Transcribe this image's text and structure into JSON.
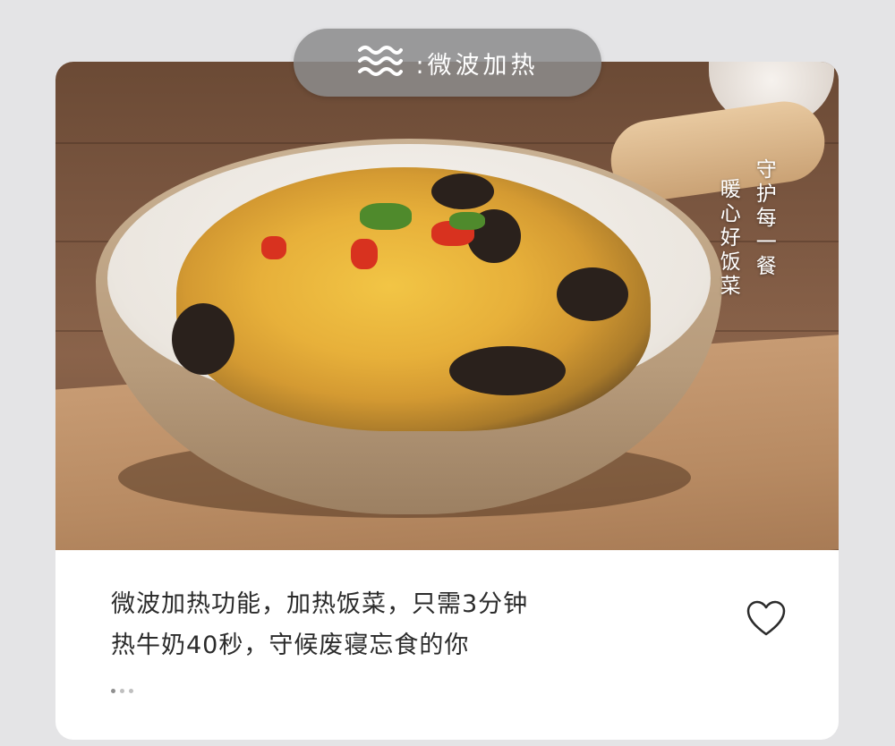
{
  "badge": {
    "icon": "heat-waves-icon",
    "label": ":微波加热"
  },
  "photo": {
    "overlay_text": [
      "暖心好饭菜",
      "守护每一餐"
    ]
  },
  "description": {
    "line1": "微波加热功能，加热饭菜，只需3分钟",
    "line2": "热牛奶40秒，守候废寝忘食的你"
  },
  "like": {
    "icon": "heart-outline-icon"
  },
  "pagination": {
    "total": 3,
    "active_index": 0
  },
  "colors": {
    "badge_bg": "#8c8c8c",
    "card_bg": "#ffffff",
    "page_bg": "#e4e4e6",
    "text": "#2b2b2b"
  }
}
